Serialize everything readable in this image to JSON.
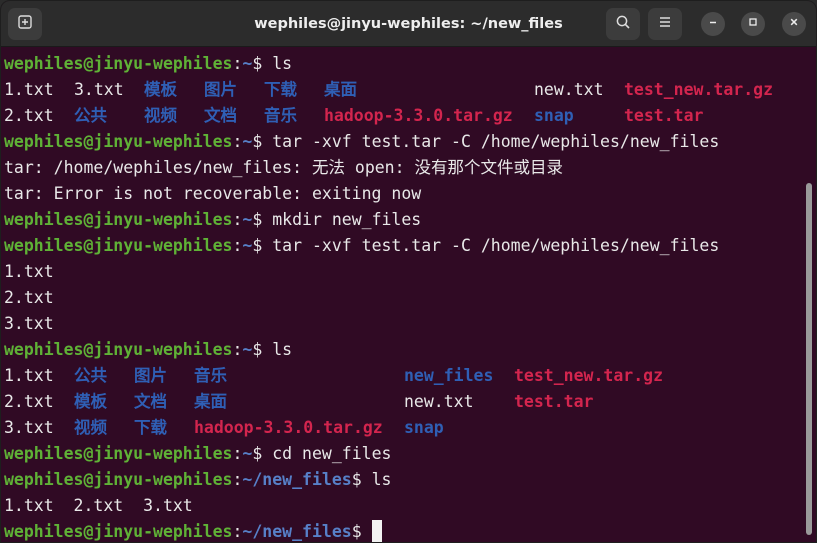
{
  "window": {
    "title": "wephiles@jinyu-wephiles: ~/new_files"
  },
  "colors": {
    "user": "#5fb236",
    "path": "#5780c8",
    "dir": "#2f5fb5",
    "archive": "#d3254e",
    "bg": "#300a24"
  },
  "icons": {
    "new_tab": "new-tab-icon",
    "search": "search-icon",
    "menu": "hamburger-menu-icon",
    "minimize": "minimize-icon",
    "maximize": "maximize-icon",
    "close": "close-icon"
  },
  "prompt": {
    "user": "wephiles@jinyu-wephiles",
    "sep": ":",
    "home": "~",
    "newdir": "~/new_files",
    "dollar": "$"
  },
  "lines": {
    "l1": {
      "cmd": " ls"
    },
    "l2": {
      "a": "1.txt",
      "b": "3.txt",
      "c": "模板",
      "d": "图片",
      "e": "下载",
      "f": "桌面",
      "g": "new.txt",
      "h": "test_new.tar.gz"
    },
    "l3": {
      "a": "2.txt",
      "b": "公共",
      "c": "视频",
      "d": "文档",
      "e": "音乐",
      "f": "hadoop-3.3.0.tar.gz",
      "g": "snap",
      "h": "test.tar"
    },
    "l4": {
      "cmd": " tar -xvf test.tar -C /home/wephiles/new_files"
    },
    "l5": {
      "text": "tar: /home/wephiles/new_files: 无法 open: 没有那个文件或目录"
    },
    "l6": {
      "text": "tar: Error is not recoverable: exiting now"
    },
    "l7": {
      "cmd": " mkdir new_files"
    },
    "l8": {
      "cmd": " tar -xvf test.tar -C /home/wephiles/new_files"
    },
    "l9": {
      "text": "1.txt"
    },
    "l10": {
      "text": "2.txt"
    },
    "l11": {
      "text": "3.txt"
    },
    "l12": {
      "cmd": " ls"
    },
    "l13": {
      "a": "1.txt",
      "b": "公共",
      "c": "图片",
      "d": "音乐",
      "e": "new_files",
      "f": "test_new.tar.gz"
    },
    "l14": {
      "a": "2.txt",
      "b": "模板",
      "c": "文档",
      "d": "桌面",
      "e": "new.txt",
      "f": "test.tar"
    },
    "l15": {
      "a": "3.txt",
      "b": "视频",
      "c": "下载",
      "d": "hadoop-3.3.0.tar.gz",
      "e": "snap"
    },
    "l16": {
      "cmd": " cd new_files"
    },
    "l17": {
      "cmd": " ls"
    },
    "l18": {
      "text": "1.txt  2.txt  3.txt"
    },
    "l19": {
      "cmd": " "
    }
  }
}
